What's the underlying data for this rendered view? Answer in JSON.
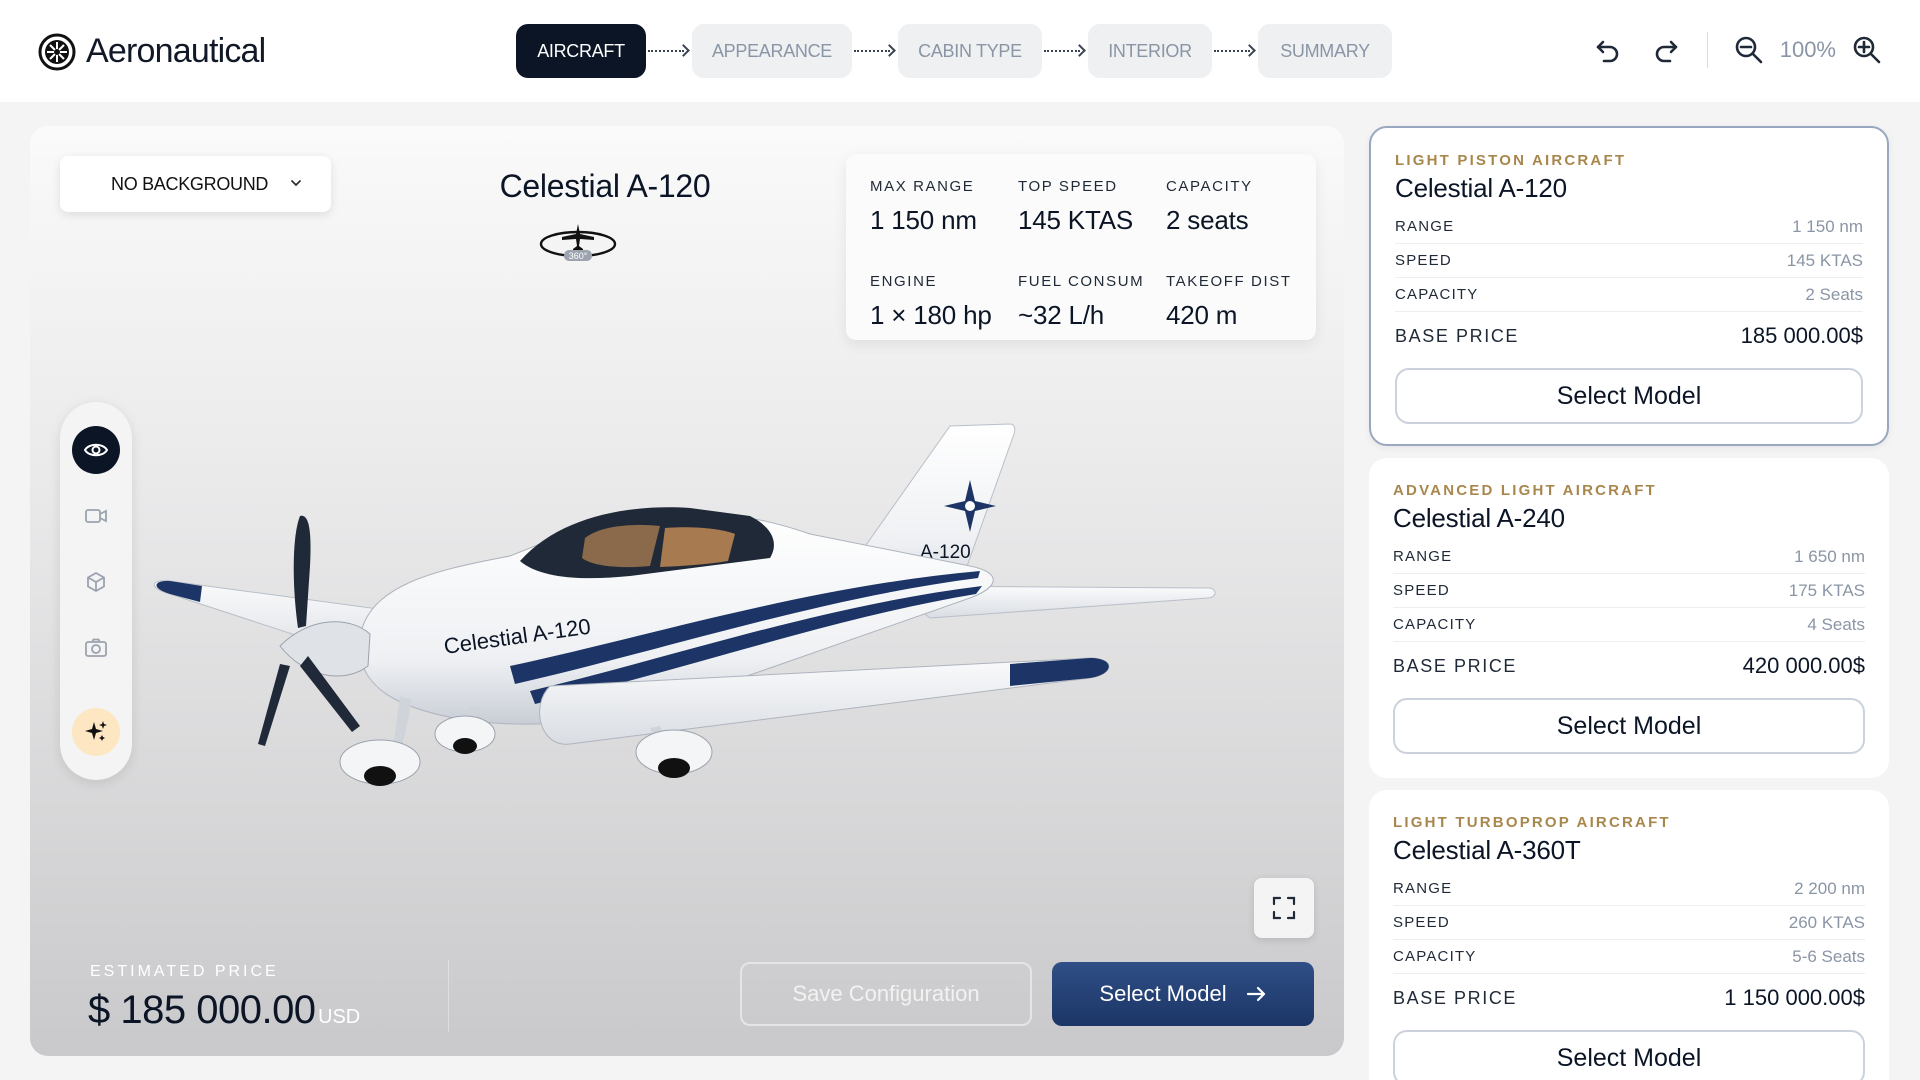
{
  "app": {
    "name": "Aeronautical"
  },
  "steps": [
    {
      "label": "AIRCRAFT",
      "active": true
    },
    {
      "label": "APPEARANCE",
      "active": false
    },
    {
      "label": "CABIN TYPE",
      "active": false
    },
    {
      "label": "INTERIOR",
      "active": false
    },
    {
      "label": "SUMMARY",
      "active": false
    }
  ],
  "toolbar": {
    "undo_icon": "undo-icon",
    "redo_icon": "redo-icon",
    "zoom_out_icon": "zoom-out-icon",
    "zoom_in_icon": "zoom-in-icon",
    "zoom": "100%"
  },
  "viewer": {
    "background_select": "NO BACKGROUND",
    "model_title": "Celestial A-120",
    "spin_label": "360°",
    "specs": [
      {
        "label": "MAX RANGE",
        "value": "1 150 nm"
      },
      {
        "label": "TOP SPEED",
        "value": "145 KTAS"
      },
      {
        "label": "CAPACITY",
        "value": "2 seats"
      },
      {
        "label": "ENGINE",
        "value": "1 × 180 hp"
      },
      {
        "label": "FUEL CONSUM",
        "value": "~32 L/h"
      },
      {
        "label": "TAKEOFF DIST",
        "value": "420 m"
      }
    ],
    "plane_tail_text": "A-120",
    "plane_fuselage_text": "Celestial A-120",
    "tools": [
      "eye-icon",
      "video-icon",
      "3d-box-icon",
      "camera-icon",
      "sparkle-icon"
    ],
    "estimated_price_label": "ESTIMATED PRICE",
    "estimated_price": "$ 185 000.00",
    "currency": "USD",
    "save_label": "Save Configuration",
    "select_label": "Select Model"
  },
  "models": [
    {
      "category": "LIGHT PISTON AIRCRAFT",
      "name": "Celestial A-120",
      "selected": true,
      "rows": [
        {
          "label": "RANGE",
          "value": "1 150 nm"
        },
        {
          "label": "SPEED",
          "value": "145 KTAS"
        },
        {
          "label": "CAPACITY",
          "value": "2 Seats"
        }
      ],
      "price_label": "BASE PRICE",
      "price": "185 000.00$",
      "button": "Select Model"
    },
    {
      "category": "ADVANCED LIGHT AIRCRAFT",
      "name": "Celestial A-240",
      "selected": false,
      "rows": [
        {
          "label": "RANGE",
          "value": "1 650 nm"
        },
        {
          "label": "SPEED",
          "value": "175 KTAS"
        },
        {
          "label": "CAPACITY",
          "value": "4 Seats"
        }
      ],
      "price_label": "BASE PRICE",
      "price": "420 000.00$",
      "button": "Select Model"
    },
    {
      "category": "LIGHT TURBOPROP AIRCRAFT",
      "name": "Celestial A-360T",
      "selected": false,
      "rows": [
        {
          "label": "RANGE",
          "value": "2 200 nm"
        },
        {
          "label": "SPEED",
          "value": "260 KTAS"
        },
        {
          "label": "CAPACITY",
          "value": "5-6 Seats"
        }
      ],
      "price_label": "BASE PRICE",
      "price": "1 150 000.00$",
      "button": "Select Model"
    }
  ],
  "colors": {
    "primary_dark": "#0b1526",
    "accent_navy": "#1c3566",
    "category_gold": "#a8874d",
    "muted": "#8a95a5"
  }
}
